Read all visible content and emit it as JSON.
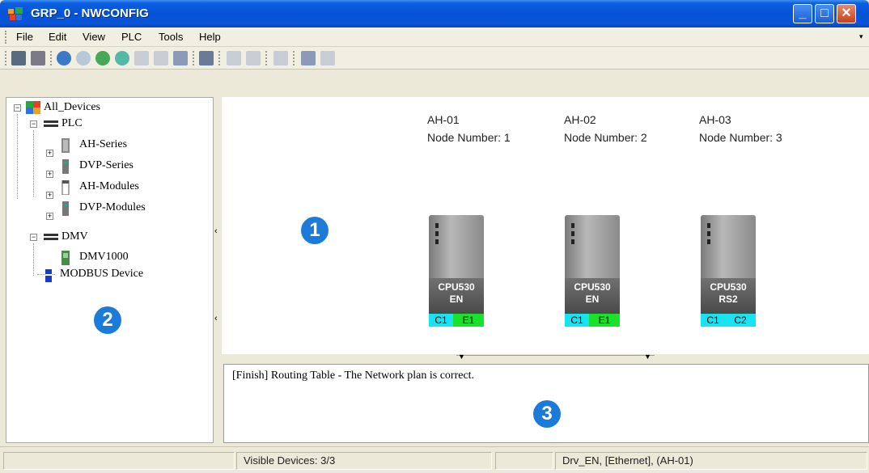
{
  "window": {
    "title": "GRP_0 - NWCONFIG",
    "minimize": "_",
    "maximize": "□",
    "close": "✕"
  },
  "menu": {
    "items": [
      "File",
      "Edit",
      "View",
      "PLC",
      "Tools",
      "Help"
    ],
    "overflow": "▾"
  },
  "toolbar": {
    "icons": [
      "save-icon",
      "print-icon",
      "online-icon",
      "offline-icon",
      "upload-icon",
      "download-icon",
      "network-icon",
      "routing-icon",
      "compile-icon",
      "properties-icon",
      "align-icon",
      "list-icon",
      "zoom-icon",
      "device-icon",
      "window-icon"
    ]
  },
  "tree": {
    "root": "All_Devices",
    "plc": "PLC",
    "ah_series": "AH-Series",
    "dvp_series": "DVP-Series",
    "ah_modules": "AH-Modules",
    "dvp_modules": "DVP-Modules",
    "dmv": "DMV",
    "dmv1000": "DMV1000",
    "modbus": "MODBUS Device",
    "expand": "+",
    "collapse": "−"
  },
  "splitter": {
    "arrow": "‹"
  },
  "devices": [
    {
      "name": "AH-01",
      "node": "Node Number: 1",
      "model": "CPU530",
      "sub": "EN",
      "port1": "C1",
      "port2": "E1"
    },
    {
      "name": "AH-02",
      "node": "Node Number: 2",
      "model": "CPU530",
      "sub": "EN",
      "port1": "C1",
      "port2": "E1"
    },
    {
      "name": "AH-03",
      "node": "Node Number: 3",
      "model": "CPU530",
      "sub": "RS2",
      "port1": "C1",
      "port2": "C2"
    }
  ],
  "badges": {
    "one": "1",
    "two": "2",
    "three": "3"
  },
  "log": {
    "message": "[Finish] Routing Table - The Network plan is correct.",
    "arrow_left": "▼",
    "arrow_right": "▼"
  },
  "status": {
    "visible_devices": "Visible Devices: 3/3",
    "driver": "Drv_EN, [Ethernet], (AH-01)"
  },
  "colors": {
    "port_cyan": "#19e3f0",
    "port_green": "#1ae22c",
    "badge": "#1c7ad8",
    "titlebar": "#0553d6"
  }
}
